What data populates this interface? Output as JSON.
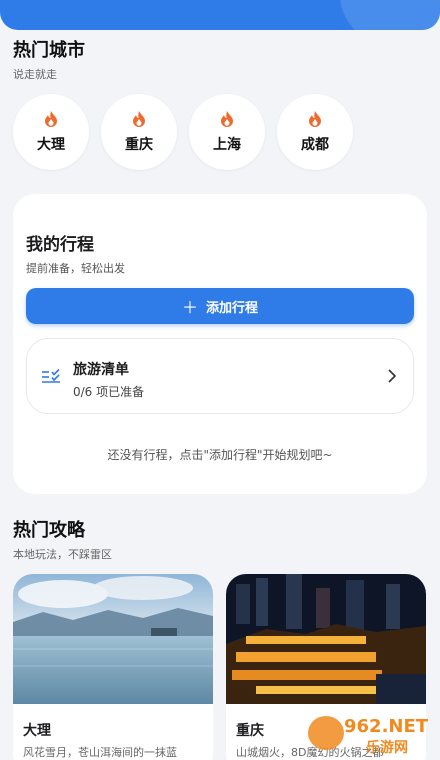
{
  "hot_cities": {
    "title": "热门城市",
    "subtitle": "说走就走",
    "icon": "flame-icon",
    "accent_color": "#ef6a2f",
    "items": [
      {
        "label": "大理"
      },
      {
        "label": "重庆"
      },
      {
        "label": "上海"
      },
      {
        "label": "成都"
      }
    ]
  },
  "my_trips": {
    "title": "我的行程",
    "subtitle": "提前准备，轻松出发",
    "add_button_label": "添加行程",
    "add_button_icon": "plus-icon",
    "checklist": {
      "title": "旅游清单",
      "progress": "0/6 项已准备",
      "icon": "checklist-icon"
    },
    "empty_text": "还没有行程，点击\"添加行程\"开始规划吧~"
  },
  "hot_guides": {
    "title": "热门攻略",
    "subtitle": "本地玩法，不踩雷区",
    "items": [
      {
        "title": "大理",
        "desc": "风花雪月，苍山洱海间的一抹蓝"
      },
      {
        "title": "重庆",
        "desc": "山城烟火，8D魔幻的火锅之都"
      }
    ]
  },
  "watermark": {
    "line1": "962.NET",
    "line2": "乐游网"
  },
  "colors": {
    "primary": "#2f7be8",
    "background": "#f2f4f8"
  }
}
